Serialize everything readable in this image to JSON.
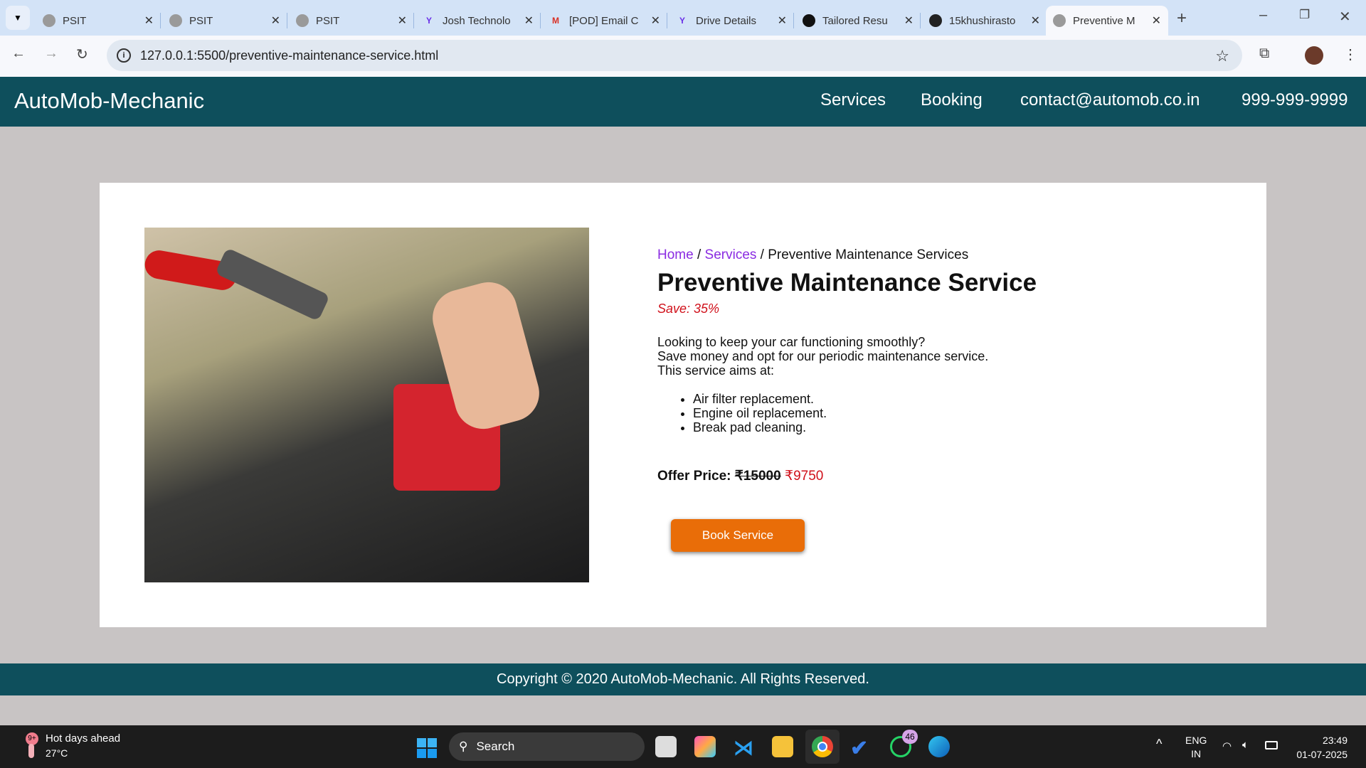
{
  "browser": {
    "tabs": [
      {
        "label": "PSIT"
      },
      {
        "label": "PSIT"
      },
      {
        "label": "PSIT"
      },
      {
        "label": "Josh Technolo"
      },
      {
        "label": "[POD] Email C"
      },
      {
        "label": "Drive Details"
      },
      {
        "label": "Tailored Resu"
      },
      {
        "label": "15khushirasto"
      },
      {
        "label": "Preventive M",
        "active": true
      }
    ],
    "url": "127.0.0.1:5500/preventive-maintenance-service.html"
  },
  "header": {
    "logo": "AutoMob-Mechanic",
    "nav": [
      "Services",
      "Booking",
      "contact@automob.co.in",
      "999-999-9999"
    ]
  },
  "breadcrumb": {
    "home": "Home",
    "sep": " / ",
    "services": "Services",
    "current": "Preventive Maintenance Services"
  },
  "product": {
    "title": "Preventive Maintenance Service",
    "save": "Save: 35%",
    "desc": [
      "Looking to keep your car functioning smoothly?",
      "Save money and opt for our periodic maintenance service.",
      "This service aims at:"
    ],
    "features": [
      "Air filter replacement.",
      "Engine oil replacement.",
      "Break pad cleaning."
    ],
    "offer_label": "Offer Price:",
    "old_price": "₹15000",
    "new_price": "₹9750",
    "book_label": "Book Service"
  },
  "footer": "Copyright © 2020 AutoMob-Mechanic. All Rights Reserved.",
  "taskbar": {
    "weather_title": "Hot days ahead",
    "weather_temp": "27°C",
    "weather_badge": "9+",
    "search": "Search",
    "whatsapp_badge": "46",
    "lang1": "ENG",
    "lang2": "IN",
    "time": "23:49",
    "date": "01-07-2025"
  },
  "colors": {
    "brand": "#0e4f5c",
    "accent": "#e96d08",
    "price": "#d0101a",
    "link": "#8a2be2"
  }
}
